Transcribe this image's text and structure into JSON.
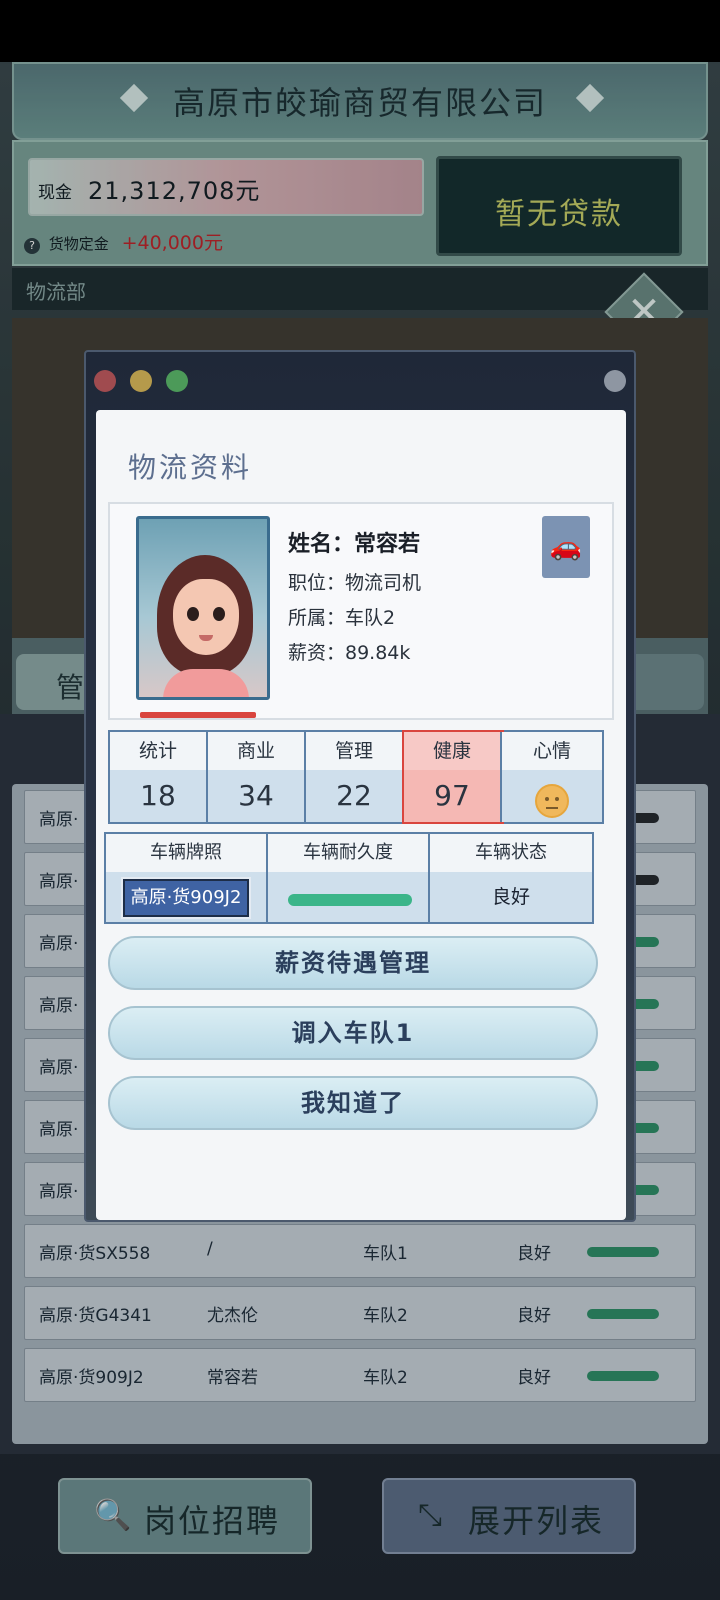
{
  "company": {
    "name": "高原市皎瑜商贸有限公司"
  },
  "finance": {
    "cash_label": "现金",
    "cash_value": "21,312,708元",
    "deposit_label": "货物定金",
    "deposit_value": "+40,000元",
    "loan_button": "暂无贷款"
  },
  "department": {
    "title": "物流部"
  },
  "background_list": {
    "tab_left_partial": "管",
    "rows": [
      {
        "plate": "高原·",
        "name": "",
        "team": "",
        "status": ""
      },
      {
        "plate": "高原·",
        "name": "",
        "team": "",
        "status": ""
      },
      {
        "plate": "高原·",
        "name": "",
        "team": "",
        "status": ""
      },
      {
        "plate": "高原·",
        "name": "",
        "team": "",
        "status": ""
      },
      {
        "plate": "高原·",
        "name": "",
        "team": "",
        "status": ""
      },
      {
        "plate": "高原·",
        "name": "",
        "team": "",
        "status": ""
      },
      {
        "plate": "高原·",
        "name": "",
        "team": "",
        "status": ""
      },
      {
        "plate": "高原·货SX558",
        "name": "/",
        "team": "车队1",
        "status": "良好"
      },
      {
        "plate": "高原·货G4341",
        "name": "尤杰伦",
        "team": "车队2",
        "status": "良好"
      },
      {
        "plate": "高原·货909J2",
        "name": "常容若",
        "team": "车队2",
        "status": "良好"
      }
    ],
    "recruit_button": "岗位招聘",
    "expand_button": "展开列表"
  },
  "modal": {
    "title": "物流资料",
    "profile": {
      "name_line": "姓名：常容若",
      "position_line": "职位：物流司机",
      "team_line": "所属：车队2",
      "salary_line": "薪资：89.84k"
    },
    "stats": [
      {
        "label": "统计",
        "value": "18"
      },
      {
        "label": "商业",
        "value": "34"
      },
      {
        "label": "管理",
        "value": "22"
      },
      {
        "label": "健康",
        "value": "97"
      },
      {
        "label": "心情",
        "value": ""
      }
    ],
    "vehicle": {
      "plate_label": "车辆牌照",
      "plate_value": "高原·货909J2",
      "durability_label": "车辆耐久度",
      "durability_fraction": 1.0,
      "status_label": "车辆状态",
      "status_value": "良好"
    },
    "buttons": {
      "salary": "薪资待遇管理",
      "transfer": "调入车队1",
      "ok": "我知道了"
    }
  },
  "colors": {
    "accent_blue": "#3f63a3",
    "health_highlight": "#d9453e",
    "good_green": "#3bb589",
    "loan_text": "#c9d06a",
    "deposit_red": "#c0272d"
  }
}
